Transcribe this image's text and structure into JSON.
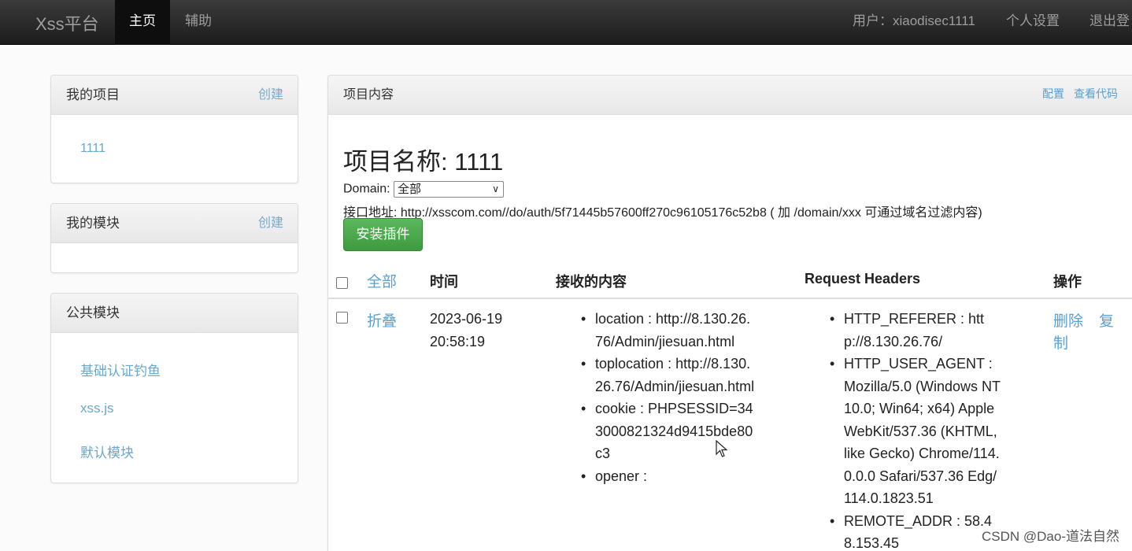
{
  "navbar": {
    "brand": "Xss平台",
    "items": [
      {
        "label": "主页",
        "active": true
      },
      {
        "label": "辅助",
        "active": false
      }
    ],
    "user": "用户：xiaodisec1111",
    "settings": "个人设置",
    "logout": "退出登"
  },
  "my_projects": {
    "title": "我的项目",
    "create": "创建",
    "items": [
      "1111"
    ]
  },
  "my_modules": {
    "title": "我的模块",
    "create": "创建"
  },
  "public_modules": {
    "title": "公共模块",
    "items": [
      "基础认证钓鱼",
      "xss.js",
      "默认模块"
    ]
  },
  "main": {
    "title": "项目内容",
    "config": "配置",
    "view_code": "查看代码",
    "project_name": "项目名称: 1111",
    "domain_label": "Domain:",
    "domain_value": "全部",
    "api_line": "接口地址: http://xsscom.com//do/auth/5f71445b57600ff270c96105176c52b8 ( 加 /domain/xxx 可通过域名过滤内容)",
    "install_button": "安装插件",
    "table": {
      "headers": {
        "all": "全部",
        "time": "时间",
        "content": "接收的内容",
        "request_headers": "Request Headers",
        "actions": "操作"
      },
      "rows": [
        {
          "collapse": "折叠",
          "time_lines": [
            "2023-06-19",
            "20:58:19"
          ],
          "content": [
            [
              "location : http://8.130.26.",
              "76/Admin/jiesuan.html"
            ],
            [
              "toplocation : http://8.130.",
              "26.76/Admin/jiesuan.html"
            ],
            [
              "cookie : PHPSESSID=34",
              "3000821324d9415bde80",
              "c3"
            ],
            [
              "opener :"
            ]
          ],
          "headers": [
            [
              "HTTP_REFERER : htt",
              "p://8.130.26.76/"
            ],
            [
              "HTTP_USER_AGENT :",
              "Mozilla/5.0 (Windows NT",
              "10.0; Win64; x64) Apple",
              "WebKit/537.36 (KHTML,",
              "like Gecko) Chrome/114.",
              "0.0.0 Safari/537.36 Edg/",
              "114.0.1823.51"
            ],
            [
              "REMOTE_ADDR : 58.4",
              "8.153.45"
            ]
          ],
          "delete": "删除",
          "copy_a": "复",
          "copy_b": "制"
        }
      ]
    }
  },
  "watermark": "CSDN @Dao-道法自然"
}
